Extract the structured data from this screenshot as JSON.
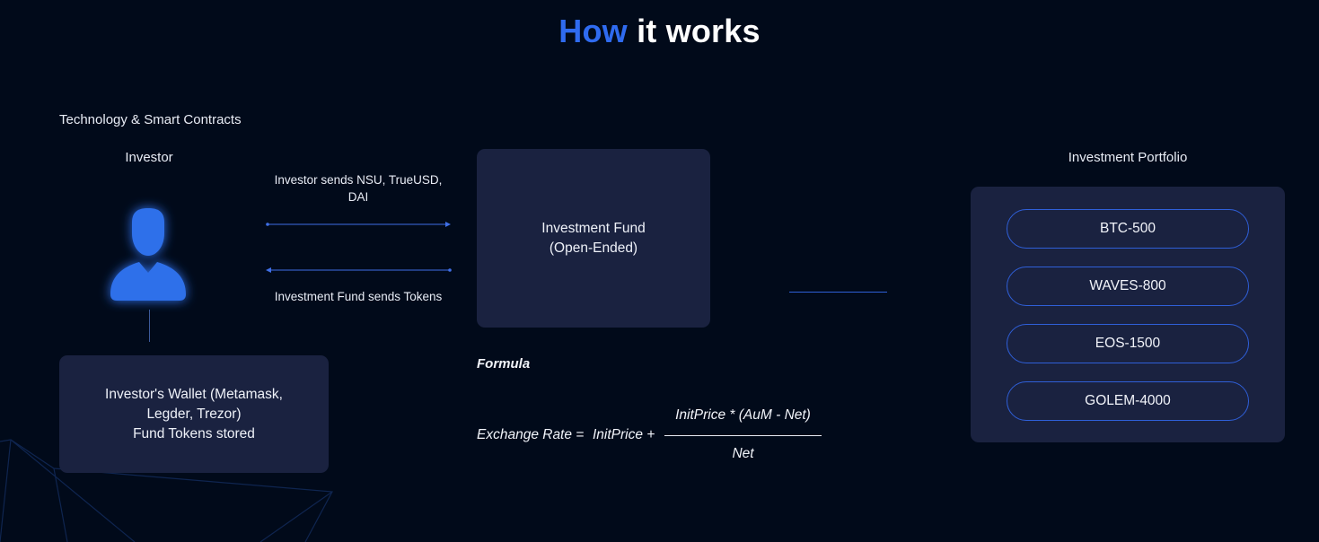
{
  "title": {
    "accent": "How",
    "rest": "it works"
  },
  "section_label": "Technology & Smart Contracts",
  "investor": {
    "label": "Investor"
  },
  "wallet": {
    "line1": "Investor's Wallet (Metamask,",
    "line2": "Legder, Trezor)",
    "line3": "Fund Tokens stored"
  },
  "arrows": {
    "send_line1": "Investor sends NSU, TrueUSD,",
    "send_line2": "DAI",
    "receive": "Investment Fund sends Tokens"
  },
  "fund": {
    "line1": "Investment Fund",
    "line2": "(Open-Ended)"
  },
  "formula": {
    "label": "Formula",
    "lhs": "Exchange Rate =",
    "term": "InitPrice +",
    "numerator": "InitPrice * (AuM - Net)",
    "denominator": "Net"
  },
  "portfolio": {
    "label": "Investment Portfolio",
    "items": [
      "BTC-500",
      "WAVES-800",
      "EOS-1500",
      "GOLEM-4000"
    ]
  },
  "colors": {
    "background": "#010a1a",
    "accent": "#2f6bf0",
    "box": "#1a2240",
    "line": "#2f5fd8"
  }
}
